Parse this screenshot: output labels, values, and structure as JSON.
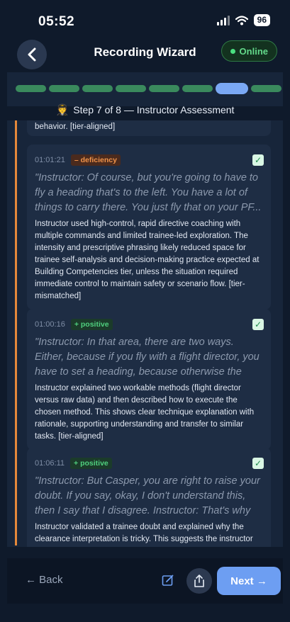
{
  "status_bar": {
    "time": "05:52",
    "battery": "96"
  },
  "header": {
    "title": "Recording Wizard",
    "online_label": "Online"
  },
  "progress": {
    "total_steps": 8,
    "current_step": 7
  },
  "step": {
    "emoji": "🧑‍✈️",
    "label": "Step 7 of 8 — Instructor Assessment"
  },
  "previous_fragment": "behavior. [tier-aligned]",
  "items": [
    {
      "timestamp": "01:01:21",
      "tag": "– deficiency",
      "tag_type": "deficiency",
      "checked": true,
      "quote": "\"Instructor: Of course, but you're going to have to fly a heading that's to the left. You have a lot of things to carry there. You just fly that on your PF...",
      "note": "Instructor used high-control, rapid directive coaching with multiple commands and limited trainee-led exploration. The intensity and prescriptive phrasing likely reduced space for trainee self-analysis and decision-making practice expected at Building Competencies tier, unless the situation required immediate control to maintain safety or scenario flow. [tier-mismatched]"
    },
    {
      "timestamp": "01:00:16",
      "tag": "+ positive",
      "tag_type": "positive",
      "checked": true,
      "quote": "\"Instructor: In that area, there are two ways. Either, because if you fly with a flight director, you have to set a heading, because otherwise the flight direct...",
      "note": "Instructor explained two workable methods (flight director versus raw data) and then described how to execute the chosen method. This shows clear technique explanation with rationale, supporting understanding and transfer to similar tasks. [tier-aligned]"
    },
    {
      "timestamp": "01:06:11",
      "tag": "+ positive",
      "tag_type": "positive",
      "checked": true,
      "quote": "\"Instructor: But Casper, you are right to raise your doubt. If you say, okay, I don't understand this, then I say that I disagree. Instructor: That's why it...",
      "note": "Instructor validated a trainee doubt and explained why the clearance interpretation is tricky. This suggests the instructor encouraged clarification and supported sense-"
    }
  ],
  "footer": {
    "back_label": "← Back",
    "next_label": "Next →"
  },
  "colors": {
    "accent": "#6d9ef2",
    "deficiency": "#f0934a",
    "positive": "#4fcf7e",
    "timeline": "#e5883a"
  }
}
